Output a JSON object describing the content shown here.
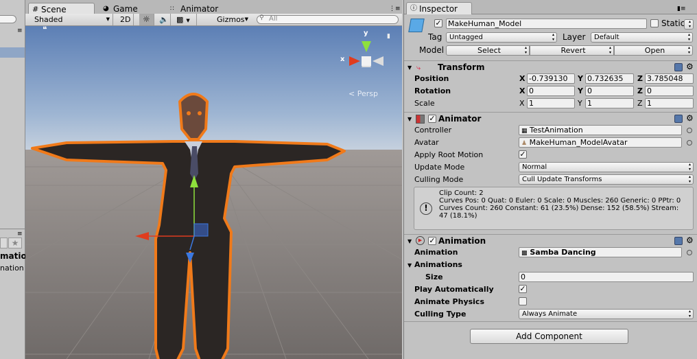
{
  "scene_window": {
    "tabs": [
      {
        "label": "Scene",
        "icon": "grid-icon"
      },
      {
        "label": "Game",
        "icon": "pacman-icon"
      },
      {
        "label": "Animator",
        "icon": "grid-dots-icon"
      }
    ],
    "toolbar": {
      "shading_mode": "Shaded",
      "view_2d": "2D",
      "gizmos": "Gizmos",
      "search_placeholder": "All"
    },
    "viewport": {
      "projection_label": "Persp",
      "gizmo_x": "x",
      "gizmo_y": "y"
    }
  },
  "left_panel": {
    "partial_labels": [
      "matio",
      "nation"
    ]
  },
  "inspector": {
    "tab_label": "Inspector",
    "object": {
      "name": "MakeHuman_Model",
      "active": true,
      "static_label": "Static",
      "static": false,
      "tag_label": "Tag",
      "tag_value": "Untagged",
      "layer_label": "Layer",
      "layer_value": "Default",
      "model_label": "Model",
      "model_buttons": [
        "Select",
        "Revert",
        "Open"
      ]
    },
    "transform": {
      "title": "Transform",
      "position_label": "Position",
      "rotation_label": "Rotation",
      "scale_label": "Scale",
      "position": {
        "x": "-0.739130",
        "y": "0.732635",
        "z": "3.785048"
      },
      "rotation": {
        "x": "0",
        "y": "0",
        "z": "0"
      },
      "scale": {
        "x": "1",
        "y": "1",
        "z": "1"
      }
    },
    "animator": {
      "title": "Animator",
      "enabled": true,
      "controller_label": "Controller",
      "controller_value": "TestAnimation",
      "avatar_label": "Avatar",
      "avatar_value": "MakeHuman_ModelAvatar",
      "apply_root_motion_label": "Apply Root Motion",
      "apply_root_motion": true,
      "update_mode_label": "Update Mode",
      "update_mode_value": "Normal",
      "culling_mode_label": "Culling Mode",
      "culling_mode_value": "Cull Update Transforms",
      "info_lines": [
        "Clip Count: 2",
        "Curves Pos: 0 Quat: 0 Euler: 0 Scale: 0 Muscles: 260 Generic: 0 PPtr: 0",
        "Curves Count: 260 Constant: 61 (23.5%) Dense: 152 (58.5%) Stream:",
        "47 (18.1%)"
      ]
    },
    "animation": {
      "title": "Animation",
      "enabled": true,
      "animation_label": "Animation",
      "animation_value": "Samba Dancing",
      "animations_label": "Animations",
      "size_label": "Size",
      "size_value": "0",
      "play_auto_label": "Play Automatically",
      "play_auto": true,
      "animate_physics_label": "Animate Physics",
      "animate_physics": false,
      "culling_type_label": "Culling Type",
      "culling_type_value": "Always Animate"
    },
    "add_component_label": "Add Component"
  },
  "colors": {
    "selection_outline": "#f07a1a",
    "gizmo_x": "#e03c1e",
    "gizmo_y": "#8ee03c",
    "gizmo_z": "#3c78e0"
  }
}
